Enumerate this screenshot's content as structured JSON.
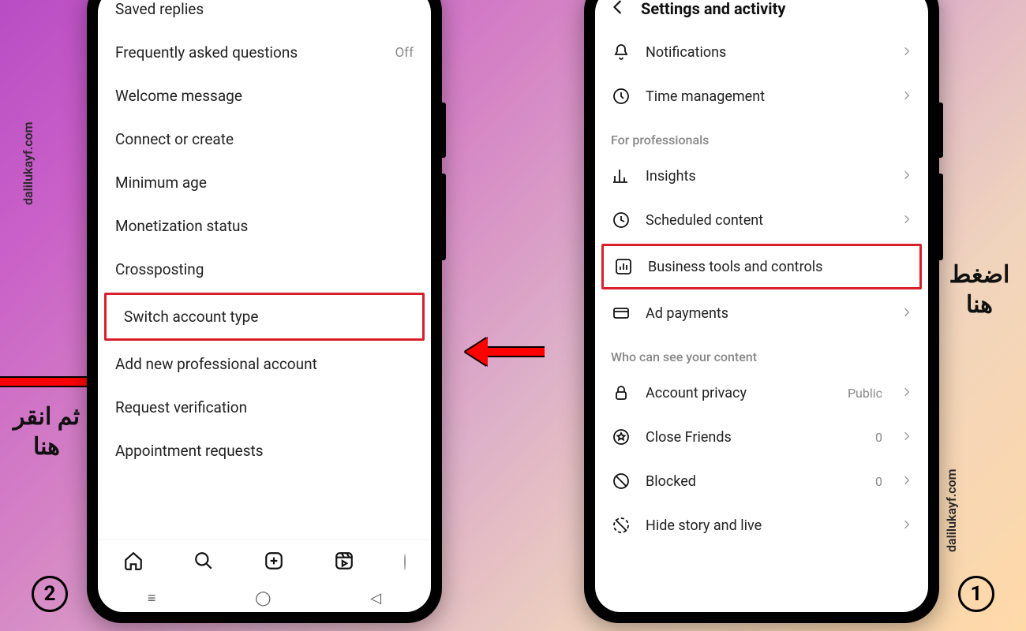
{
  "watermark": "dalilukayf.com",
  "step_badges": {
    "left": "2",
    "right": "1"
  },
  "callouts": {
    "right": "اضغط هنا",
    "left": "ثم انقر هنا"
  },
  "right_phone": {
    "header": "Settings and activity",
    "rows_top": [
      {
        "icon": "bell",
        "label": "Notifications"
      },
      {
        "icon": "clock",
        "label": "Time management"
      }
    ],
    "section_pro": "For professionals",
    "rows_pro": [
      {
        "icon": "bars",
        "label": "Insights"
      },
      {
        "icon": "clock2",
        "label": "Scheduled content"
      },
      {
        "icon": "chart",
        "label": "Business tools and controls",
        "highlight": true
      },
      {
        "icon": "card",
        "label": "Ad payments"
      }
    ],
    "section_who": "Who can see your content",
    "rows_who": [
      {
        "icon": "lock",
        "label": "Account privacy",
        "value": "Public"
      },
      {
        "icon": "star",
        "label": "Close Friends",
        "value": "0"
      },
      {
        "icon": "block",
        "label": "Blocked",
        "value": "0"
      },
      {
        "icon": "hide",
        "label": "Hide story and live"
      }
    ]
  },
  "left_phone": {
    "rows": [
      {
        "label": "Saved replies"
      },
      {
        "label": "Frequently asked questions",
        "value": "Off"
      },
      {
        "label": "Welcome message"
      },
      {
        "label": "Connect or create"
      },
      {
        "label": "Minimum age"
      },
      {
        "label": "Monetization status"
      },
      {
        "label": "Crossposting"
      },
      {
        "label": "Switch account type",
        "highlight": true
      },
      {
        "label": "Add new professional account"
      },
      {
        "label": "Request verification"
      },
      {
        "label": "Appointment requests"
      }
    ]
  }
}
